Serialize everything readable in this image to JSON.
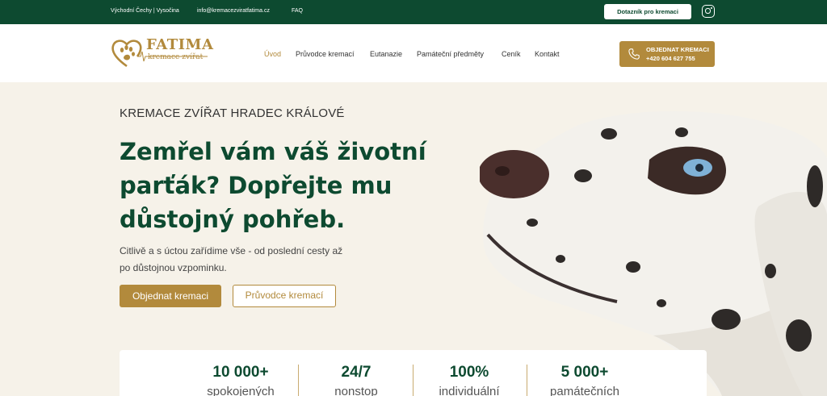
{
  "topbar": {
    "region": "Východní Čechy | Vysočina",
    "email": "info@kremacezviratfatima.cz",
    "faq": "FAQ",
    "button": "Dotazník pro kremaci",
    "instagram_icon": "instagram-icon"
  },
  "logo": {
    "name": "FATIMA",
    "sub": "kremace zvířat",
    "icon": "heart-paw-icon"
  },
  "nav": {
    "items": [
      "Úvod",
      "Průvodce kremací",
      "Eutanazie",
      "Památeční předměty",
      "Ceník",
      "Kontakt"
    ],
    "active_index": 0
  },
  "cta": {
    "line1": "OBJEDNAT KREMACI",
    "line2": "+420 604 627 755",
    "icon": "phone-icon"
  },
  "hero": {
    "kicker": "KREMACE ZVÍŘAT HRADEC KRÁLOVÉ",
    "title": "Zemřel vám váš životní parťák? Dopřejte mu důstojný pohřeb.",
    "text": "Citlivě a s úctou zařídime vše - od poslední cesty až po důstojnou vzpominku.",
    "primary_button": "Objednat kremaci",
    "secondary_button": "Průvodce kremací",
    "image": "dalmatian-dog-photo"
  },
  "stats": [
    {
      "value": "10 000+",
      "label": "spokojených"
    },
    {
      "value": "24/7",
      "label": "nonstop"
    },
    {
      "value": "100%",
      "label": "individuální"
    },
    {
      "value": "5 000+",
      "label": "památečních"
    }
  ],
  "colors": {
    "brand_green": "#0d4a30",
    "brand_gold": "#b28a3c",
    "hero_bg": "#f6f2e9"
  }
}
